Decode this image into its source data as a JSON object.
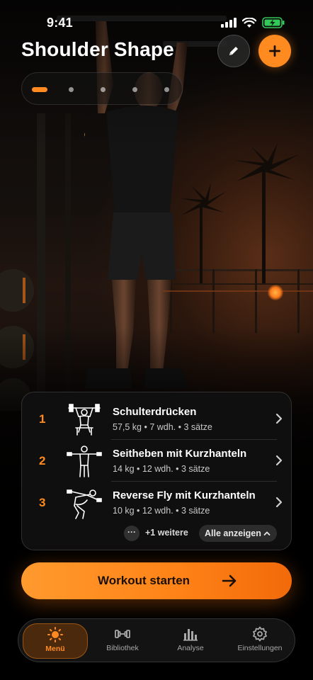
{
  "status_bar": {
    "time": "9:41",
    "signal_icon": "signal-bars-icon",
    "wifi_icon": "wifi-icon",
    "battery_icon": "battery-charging-icon",
    "battery_color": "#34c759"
  },
  "header": {
    "title": "Shoulder Shape",
    "edit_icon": "pencil-icon",
    "add_icon": "plus-icon"
  },
  "pager": {
    "pages": 5,
    "active_index": 0
  },
  "exercises": [
    {
      "number": "1",
      "name": "Schulterdrücken",
      "meta": "57,5 kg  •  7 wdh.  •  3 sätze",
      "icon": "shoulder-press-figure-icon"
    },
    {
      "number": "2",
      "name": "Seitheben mit Kurzhanteln",
      "meta": "14 kg  •  12 wdh.  •  3 sätze",
      "icon": "lateral-raise-figure-icon"
    },
    {
      "number": "3",
      "name": "Reverse Fly mit Kurzhanteln",
      "meta": "10 kg  •  12 wdh.  •  3 sätze",
      "icon": "reverse-fly-figure-icon"
    }
  ],
  "more": {
    "dots": "···",
    "label": "+1 weitere",
    "show_all": "Alle anzeigen"
  },
  "start_button": {
    "label": "Workout starten",
    "icon": "arrow-right-icon"
  },
  "tabs": [
    {
      "label": "Menü",
      "icon": "sun-icon",
      "active": true
    },
    {
      "label": "Bibliothek",
      "icon": "dumbbell-icon",
      "active": false
    },
    {
      "label": "Analyse",
      "icon": "bar-chart-icon",
      "active": false
    },
    {
      "label": "Einstellungen",
      "icon": "gear-icon",
      "active": false
    }
  ],
  "colors": {
    "accent": "#ff8a1f",
    "card_bg": "#101010",
    "text_secondary": "#c9c9c9"
  }
}
